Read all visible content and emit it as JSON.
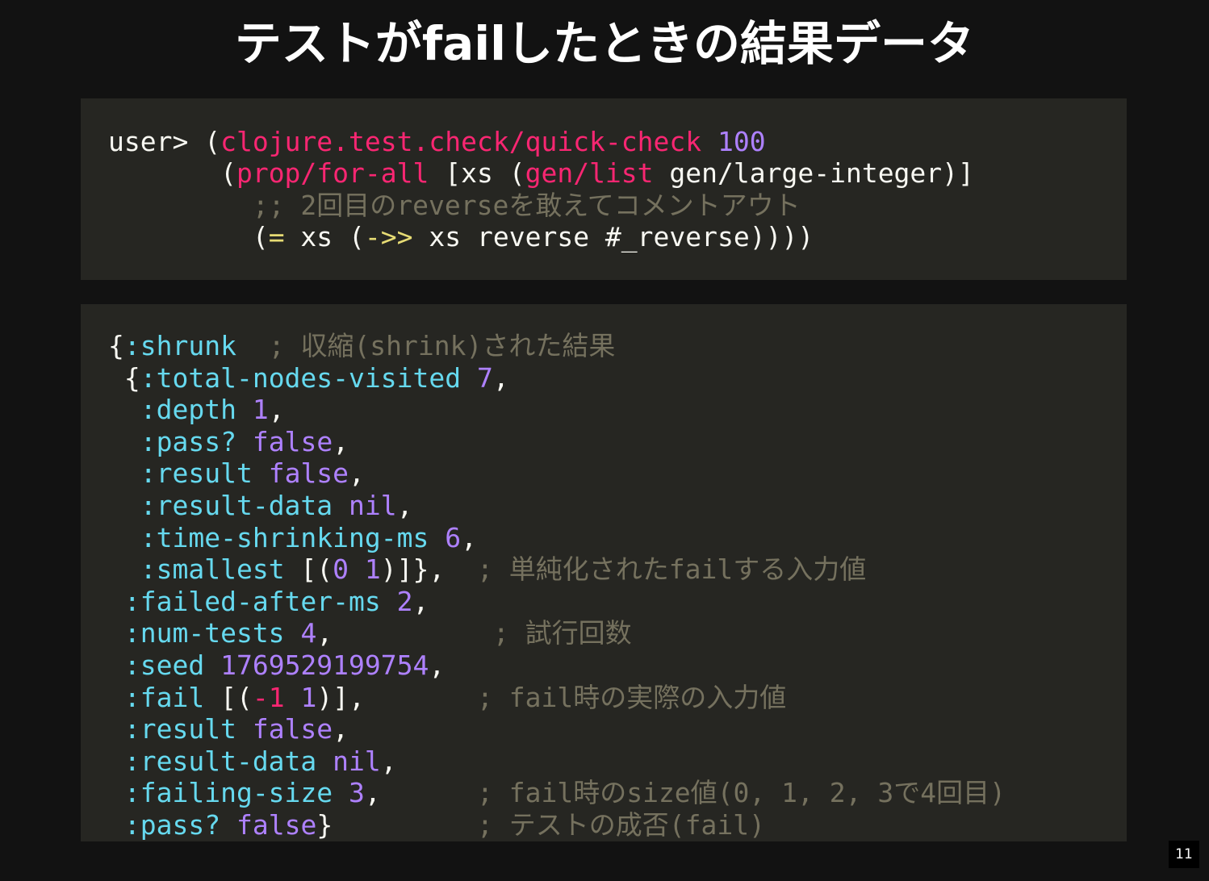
{
  "slide": {
    "title": "テストがfailしたときの結果データ",
    "page_number": "11"
  },
  "colors": {
    "background": "#121212",
    "code_background": "#262622",
    "fn_pink": "#f92672",
    "number_purple": "#ae81ff",
    "keyword_cyan": "#66d9ef",
    "comment_gray": "#75715e",
    "arrow_yellow": "#e6db74",
    "text_white": "#f8f8f2"
  },
  "code_input": {
    "l1": {
      "prompt": "user> ",
      "paren": "(",
      "fn": "clojure.test.check/quick-check",
      "sp": " ",
      "num": "100"
    },
    "l2": {
      "indent": "       ",
      "paren": "(",
      "fn": "prop/for-all",
      "a": " [xs (",
      "fn2": "gen/list",
      "b": " gen/large-integer)]"
    },
    "l3": {
      "indent": "         ",
      "comment": ";; 2回目のreverseを敢えてコメントアウト"
    },
    "l4": {
      "indent": "         ",
      "paren": "(",
      "eq": "=",
      "a": " xs (",
      "arrow": "->>",
      "b": " xs reverse #_reverse))))"
    }
  },
  "code_output": {
    "l1": {
      "brace": "{",
      "key": ":shrunk",
      "pad": "  ",
      "comment": "; 収縮(shrink)された結果"
    },
    "l2": {
      "indent": " {",
      "key": ":total-nodes-visited",
      "sp": " ",
      "num": "7",
      "end": ","
    },
    "l3": {
      "indent": "  ",
      "key": ":depth",
      "sp": " ",
      "num": "1",
      "end": ","
    },
    "l4": {
      "indent": "  ",
      "key": ":pass?",
      "sp": " ",
      "val": "false",
      "end": ","
    },
    "l5": {
      "indent": "  ",
      "key": ":result",
      "sp": " ",
      "val": "false",
      "end": ","
    },
    "l6": {
      "indent": "  ",
      "key": ":result-data",
      "sp": " ",
      "val": "nil",
      "end": ","
    },
    "l7": {
      "indent": "  ",
      "key": ":time-shrinking-ms",
      "sp": " ",
      "num": "6",
      "end": ","
    },
    "l8": {
      "indent": "  ",
      "key": ":smallest",
      "a": " [(",
      "n1": "0",
      "sp": " ",
      "n2": "1",
      "b": ")]},",
      "pad": "  ",
      "comment": "; 単純化されたfailする入力値"
    },
    "l9": {
      "indent": " ",
      "key": ":failed-after-ms",
      "sp": " ",
      "num": "2",
      "end": ","
    },
    "l10": {
      "indent": " ",
      "key": ":num-tests",
      "sp": " ",
      "num": "4",
      "end": ",",
      "pad": "          ",
      "comment": "; 試行回数"
    },
    "l11": {
      "indent": " ",
      "key": ":seed",
      "sp": " ",
      "num": "1769529199754",
      "end": ","
    },
    "l12": {
      "indent": " ",
      "key": ":fail",
      "a": " [(",
      "neg": "-1",
      "sp": " ",
      "n2": "1",
      "b": ")],",
      "pad": "       ",
      "comment": "; fail時の実際の入力値"
    },
    "l13": {
      "indent": " ",
      "key": ":result",
      "sp": " ",
      "val": "false",
      "end": ","
    },
    "l14": {
      "indent": " ",
      "key": ":result-data",
      "sp": " ",
      "val": "nil",
      "end": ","
    },
    "l15": {
      "indent": " ",
      "key": ":failing-size",
      "sp": " ",
      "num": "3",
      "end": ",",
      "pad": "      ",
      "comment": "; fail時のsize値(0, 1, 2, 3で4回目)"
    },
    "l16": {
      "indent": " ",
      "key": ":pass?",
      "sp": " ",
      "val": "false",
      "end": "}",
      "pad": "         ",
      "comment": "; テストの成否(fail)"
    }
  }
}
